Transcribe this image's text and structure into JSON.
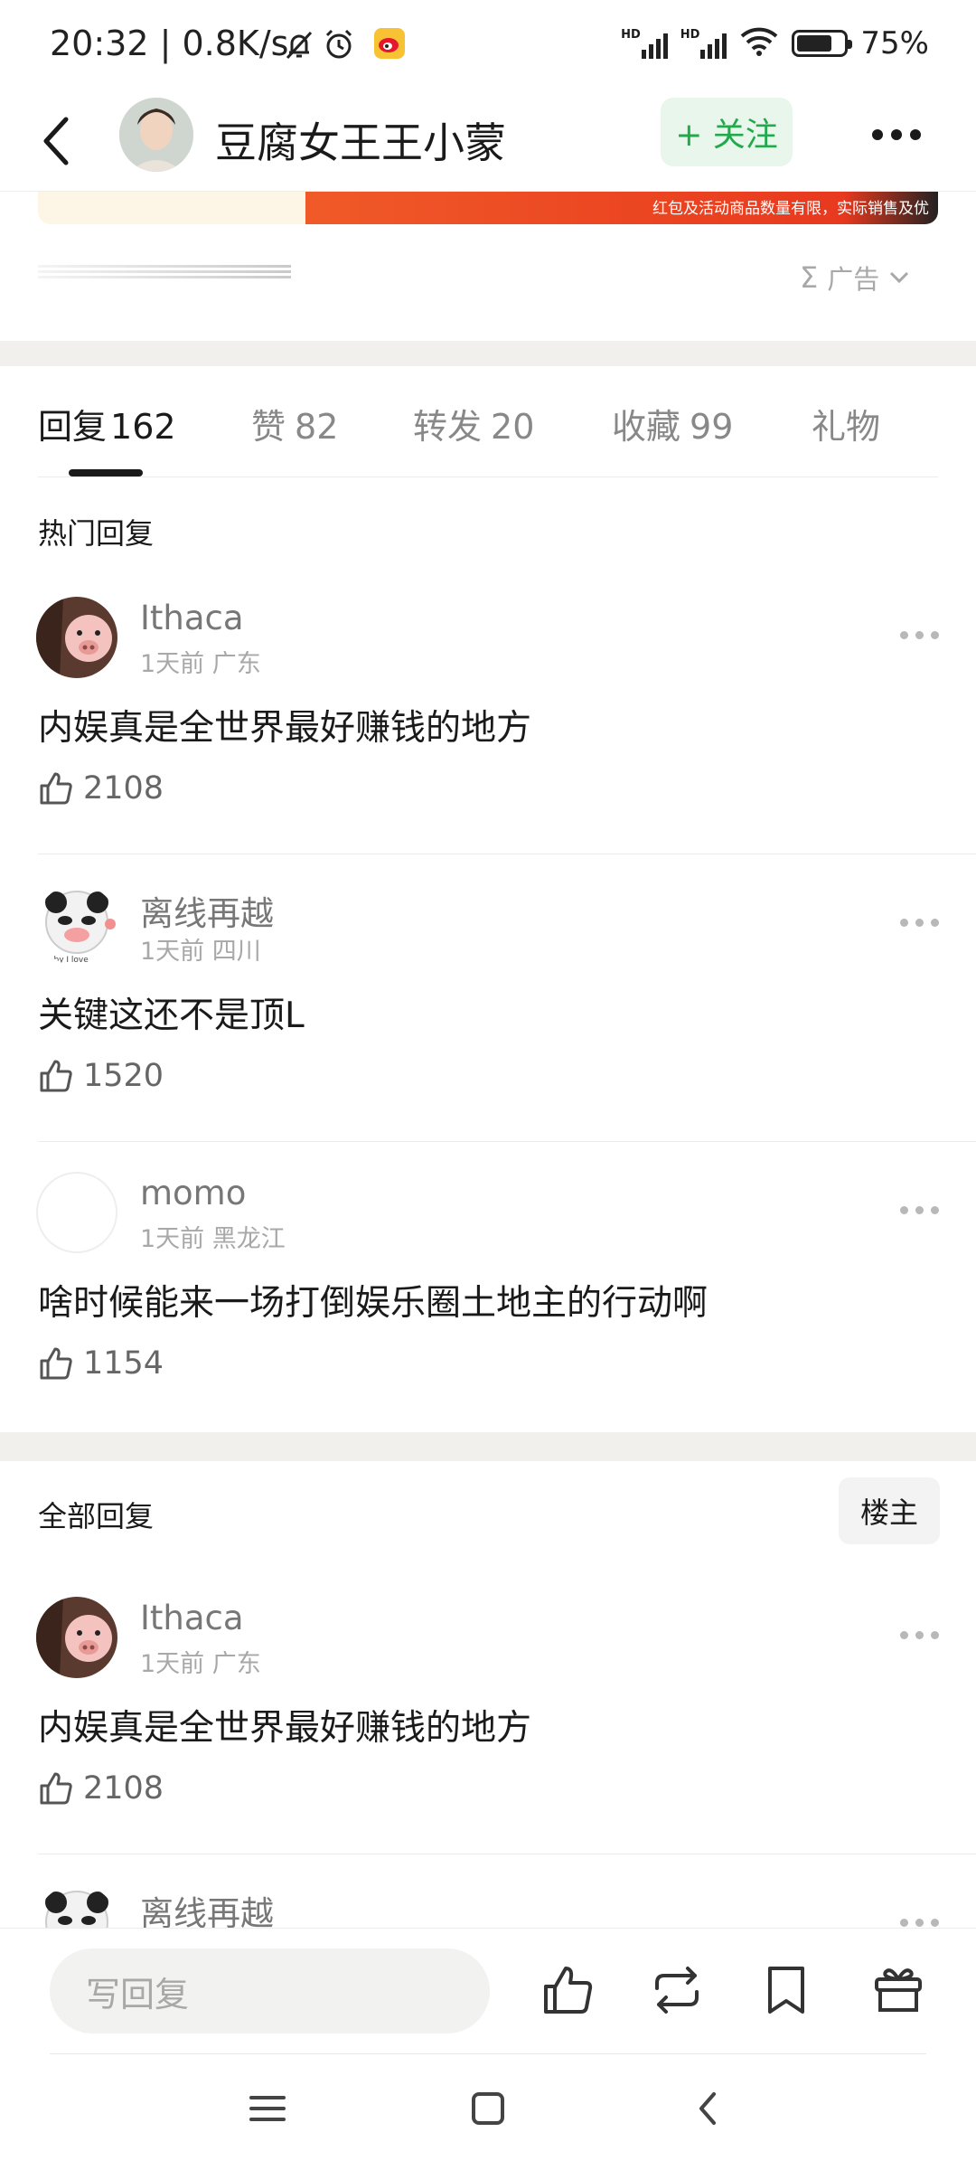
{
  "status_bar": {
    "time": "20:32 | 0.8K/s",
    "battery": "75%",
    "hd_label": "HD",
    "battery_level": 0.75
  },
  "header": {
    "title": "豆腐女王王小蒙",
    "follow_label": "+ 关注"
  },
  "ad": {
    "banner_text": "红包及活动商品数量有限，实际销售及优",
    "label": "广告"
  },
  "tabs": [
    {
      "label": "回复",
      "count": "162"
    },
    {
      "label": "赞",
      "count": "82"
    },
    {
      "label": "转发",
      "count": "20"
    },
    {
      "label": "收藏",
      "count": "99"
    },
    {
      "label": "礼物",
      "count": ""
    }
  ],
  "hot_section_title": "热门回复",
  "all_section_title": "全部回复",
  "owner_button": "楼主",
  "hot_comments": [
    {
      "name": "Ithaca",
      "time": "1天前",
      "location": "广东",
      "text": "内娱真是全世界最好赚钱的地方",
      "likes": "2108"
    },
    {
      "name": "离线再越",
      "time": "1天前",
      "location": "四川",
      "text": "关键这还不是顶L",
      "likes": "1520"
    },
    {
      "name": "momo",
      "time": "1天前",
      "location": "黑龙江",
      "text": "啥时候能来一场打倒娱乐圈土地主的行动啊",
      "likes": "1154"
    }
  ],
  "all_comments": [
    {
      "name": "Ithaca",
      "time": "1天前",
      "location": "广东",
      "text": "内娱真是全世界最好赚钱的地方",
      "likes": "2108"
    },
    {
      "name": "离线再越",
      "time": "",
      "location": "",
      "text": "",
      "likes": ""
    }
  ],
  "bottom_bar": {
    "reply_placeholder": "写回复",
    "icons": [
      "like-icon",
      "repost-icon",
      "bookmark-icon",
      "gift-icon"
    ]
  },
  "colors": {
    "accent_green": "#21a94c",
    "follow_bg": "#e9f6ec",
    "ad_orange": "#f05a28"
  }
}
